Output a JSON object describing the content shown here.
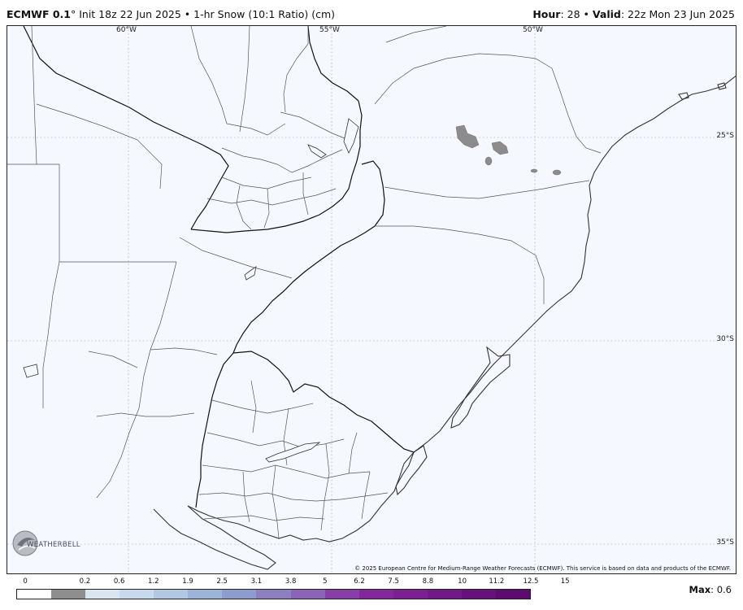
{
  "header": {
    "model": "ECMWF 0.1",
    "degree_symbol": "°",
    "init_text": "Init 18z 22 Jun 2025",
    "separator": "•",
    "product": "1-hr Snow (10:1 Ratio) (cm)",
    "hour_label": "Hour",
    "hour_value": "28",
    "valid_label": "Valid",
    "valid_value": "22z Mon 23 Jun 2025"
  },
  "map": {
    "lon_labels": [
      "60°W",
      "55°W",
      "50°W"
    ],
    "lat_labels": [
      "25°S",
      "30°S",
      "35°S"
    ],
    "snow_color": "#8c8c8c",
    "copyright": "© 2025 European Centre for Medium-Range Weather Forecasts (ECMWF). This service is based on data and products of the ECMWF."
  },
  "logo": {
    "text": "WEATHERBELL"
  },
  "legend": {
    "ticks": [
      "0",
      "0.2",
      "0.6",
      "1.2",
      "1.9",
      "2.5",
      "3.1",
      "3.8",
      "5",
      "6.2",
      "7.5",
      "8.8",
      "10",
      "11.2",
      "12.5",
      "15"
    ],
    "colors": [
      "#ffffff",
      "#8e8e8e",
      "#d9e6f0",
      "#c7d9ea",
      "#b2c8e2",
      "#9cb4d8",
      "#8d9ccd",
      "#8e7fc1",
      "#8c64b5",
      "#873ea6",
      "#82279c",
      "#7c1f91",
      "#711987",
      "#66127b",
      "#5b0c6e"
    ]
  },
  "max": {
    "label": "Max",
    "value": "0.6"
  }
}
